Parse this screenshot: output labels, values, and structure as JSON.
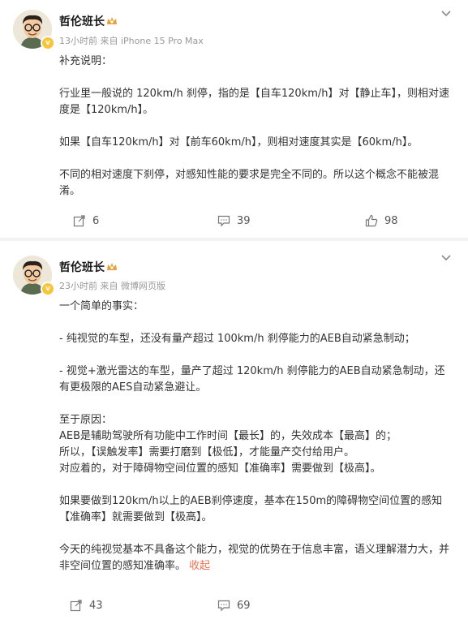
{
  "posts": [
    {
      "author": "哲伦班长",
      "time_source": "13小时前 来自 iPhone 15 Pro Max",
      "paragraphs": [
        "补充说明：",
        "",
        "行业里一般说的 120km/h 刹停，指的是【自车120km/h】对【静止车】，则相对速度是【120km/h】。",
        "",
        "如果【自车120km/h】对【前车60km/h】，则相对速度其实是【60km/h】。",
        "",
        "不同的相对速度下刹停，对感知性能的要求是完全不同的。所以这个概念不能被混淆。"
      ],
      "actions": {
        "repost": "6",
        "comment": "39",
        "like": "98"
      }
    },
    {
      "author": "哲伦班长",
      "time_source": "23小时前 来自 微博网页版",
      "paragraphs": [
        "一个简单的事实：",
        "",
        "- 纯视觉的车型，还没有量产超过 100km/h 刹停能力的AEB自动紧急制动；",
        "",
        "- 视觉+激光雷达的车型，量产了超过 120km/h 刹停能力的AEB自动紧急制动，还有更极限的AES自动紧急避让。",
        "",
        "至于原因：",
        "AEB是辅助驾驶所有功能中工作时间【最长】的，失效成本【最高】的；",
        "所以，【误触发率】需要打磨到【极低】，才能量产交付给用户。",
        "对应着的，对于障碍物空间位置的感知【准确率】需要做到【极高】。",
        "",
        "如果要做到120km/h以上的AEB刹停速度，基本在150m的障碍物空间位置的感知【准确率】就需要做到【极高】。",
        "",
        "今天的纯视觉基本不具备这个能力，视觉的优势在于信息丰富，语义理解潜力大，并非空间位置的感知准确率。"
      ],
      "collapse": "收起",
      "actions": {
        "repost": "43",
        "comment": "69",
        "like": ""
      }
    }
  ],
  "badge_mark": "v",
  "colors": {
    "link": "#eb7350",
    "badge": "#f8c43a",
    "crown": "#e6a23c"
  },
  "icons": [
    "chevron-down-icon",
    "crown-icon",
    "repost-icon",
    "comment-icon",
    "like-icon"
  ]
}
